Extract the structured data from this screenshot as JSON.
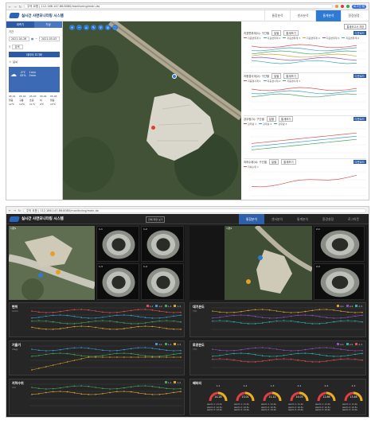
{
  "screenshot1": {
    "browser": {
      "url": "주의 요함 | 112.186.147.86:8080/monitoring/main.do",
      "profile": "로그인 됨"
    },
    "app_title": "실시간 사면모니터링 시스템",
    "tabs": [
      {
        "label": "통합분석",
        "active": false
      },
      {
        "label": "센서분석",
        "active": false
      },
      {
        "label": "통계분석",
        "active": true
      },
      {
        "label": "환경설정",
        "active": false
      }
    ],
    "sidebar": {
      "header_tabs": [
        "계측기",
        "기상"
      ],
      "period_label": "기간",
      "date_from": "2021-04-26",
      "date_to": "2021-05-03",
      "search_button": "검색",
      "reset_button": "데이터 초기화",
      "weather_title": "날씨",
      "weather_values": {
        "temp": "-3℃",
        "humidity": "45%",
        "wind": "1m/s",
        "rain": "0mm"
      },
      "weather_grid": [
        "05.01",
        "05.02",
        "05.03",
        "05.04",
        "05.05",
        "맑음",
        "구름",
        "흐림",
        "비",
        "맑음",
        "12℃",
        "14℃",
        "11℃",
        "9℃",
        "15℃"
      ]
    },
    "map_tools": [
      "+",
      "−",
      "⌂",
      "✎",
      "⚲",
      "◎",
      "⬚"
    ],
    "right_panel": {
      "save_button": "통계보고서 저장",
      "panels": [
        {
          "title": "지표변위계(1): 구간별",
          "select": "일별",
          "search": "통계보기",
          "download": "다운로드",
          "legend": [
            "지표변위계 1",
            "지표변위계 2",
            "지표변위계 3",
            "지표변위계 4",
            "지표변위계 5",
            "지표변위계 6"
          ]
        },
        {
          "title": "지중경사계(2): 구간별",
          "select": "일별",
          "search": "통계보기",
          "download": "다운로드",
          "legend": [
            "지중경사계 1",
            "지중경사계 2",
            "지중경사계 3"
          ]
        },
        {
          "title": "강우량(3): 구간별",
          "select": "일별",
          "search": "통계보기",
          "download": "다운로드",
          "legend": [
            "강우량 1",
            "강우량 2",
            "강우량 3"
          ]
        },
        {
          "title": "지하수위(4): 구간별",
          "select": "일별",
          "search": "통계보기",
          "download": "다운로드",
          "legend": [
            "지하수위 1"
          ]
        }
      ]
    }
  },
  "screenshot2": {
    "browser": {
      "url": "주의 요함 | 112.186.147.86:8080/monitoring/main.do"
    },
    "app_title": "실시간 사면모니터링 시스템",
    "fullscreen_button": "전체 화면 보기",
    "tabs": [
      {
        "label": "통합분석",
        "active": true
      },
      {
        "label": "센서분석",
        "active": false
      },
      {
        "label": "통계분석",
        "active": false
      },
      {
        "label": "환경설정",
        "active": false
      },
      {
        "label": "로그아웃",
        "active": false
      }
    ],
    "site_labels": [
      "사면1",
      "사면2"
    ],
    "camera_labels": [
      "1-1",
      "1-2",
      "1-3",
      "1-4",
      "2-1",
      "2-2"
    ],
    "charts": [
      {
        "title": "변위",
        "unit": "(mm)",
        "legend": [
          "1-1",
          "1-2",
          "1-3",
          "1-4"
        ]
      },
      {
        "title": "기울기",
        "unit": "(deg)",
        "legend": [
          "1-1",
          "1-2",
          "1-3"
        ]
      },
      {
        "title": "지하수위",
        "unit": "(m)",
        "legend": [
          "1-1",
          "1-2"
        ]
      },
      {
        "title": "대기온도",
        "unit": "(℃)",
        "legend": [
          "2-1",
          "2-2",
          "2-3"
        ]
      },
      {
        "title": "토양온도",
        "unit": "(℃)",
        "legend": [
          "2-1",
          "2-2",
          "2-3"
        ]
      },
      {
        "title": "배터리",
        "unit": "",
        "legend": []
      }
    ],
    "gauges": [
      {
        "name": "1-1",
        "value": "14.28",
        "stats": [
          "alarm 1: 11.0v",
          "alarm 2: 12.5v",
          "alarm 3: 13.0v"
        ]
      },
      {
        "name": "1-2",
        "value": "13.01",
        "stats": [
          "alarm 1: 11.0v",
          "alarm 2: 12.5v",
          "alarm 3: 13.0v"
        ]
      },
      {
        "name": "1-3",
        "value": "11.12",
        "stats": [
          "alarm 1: 11.0v",
          "alarm 2: 12.5v",
          "alarm 3: 13.0v"
        ]
      },
      {
        "name": "2-1",
        "value": "14.03",
        "stats": [
          "alarm 1: 11.0v",
          "alarm 2: 12.5v",
          "alarm 3: 13.0v"
        ]
      },
      {
        "name": "2-2",
        "value": "12.86",
        "stats": [
          "alarm 1: 11.0v",
          "alarm 2: 12.5v",
          "alarm 3: 13.0v"
        ]
      },
      {
        "name": "2-3",
        "value": "13.48",
        "stats": [
          "alarm 1: 11.0v",
          "alarm 2: 12.5v",
          "alarm 3: 13.0v"
        ]
      }
    ]
  },
  "colors": {
    "accent": "#2e7bd6",
    "header_blue": "#2d5aa6",
    "dark_bg": "#1e1e1e"
  }
}
